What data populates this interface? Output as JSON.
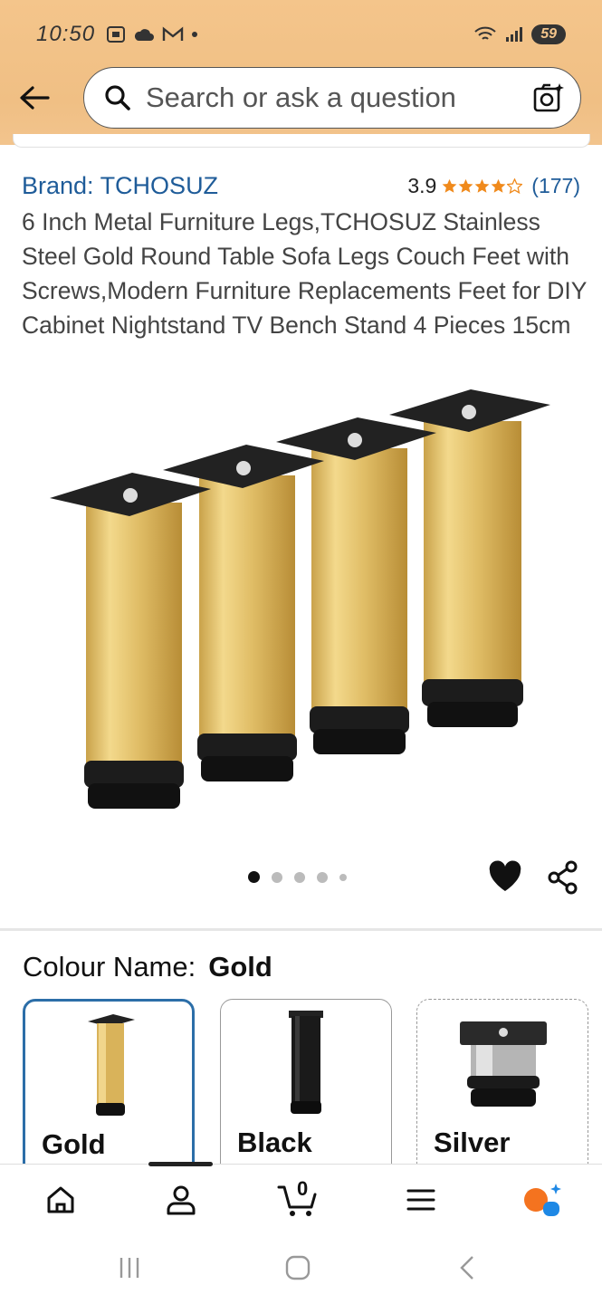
{
  "status_bar": {
    "time": "10:50",
    "battery": "59"
  },
  "search": {
    "placeholder": "Search or ask a question"
  },
  "product": {
    "brand": "Brand: TCHOSUZ",
    "rating": "3.9",
    "rating_value": 3.9,
    "rating_count": "(177)",
    "title": "6 Inch Metal Furniture Legs,TCHOSUZ Stainless Steel Gold Round Table Sofa Legs Couch Feet with Screws,Modern Furniture Replacements Feet for DIY Cabinet Nightstand TV Bench Stand 4 Pieces 15cm",
    "image_count": 5,
    "active_image": 1
  },
  "colour": {
    "label": "Colour Name:",
    "selected": "Gold",
    "options": [
      {
        "name": "Gold"
      },
      {
        "name": "Black"
      },
      {
        "name": "Silver"
      }
    ]
  },
  "cart": {
    "count": "0"
  },
  "colors": {
    "header_bg": "#f4c58b",
    "link_blue": "#1f5c99",
    "star_orange": "#f08a1c",
    "selected_border": "#2c6ea8",
    "assistant_orange": "#f4731f",
    "assistant_blue": "#1e88e5"
  }
}
